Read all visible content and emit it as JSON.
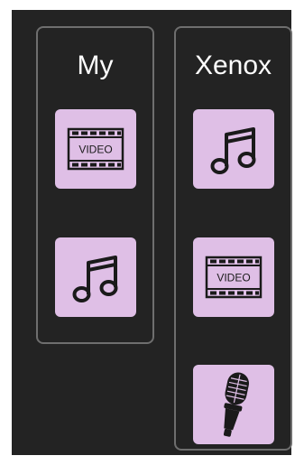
{
  "colors": {
    "screen_background": "#232323",
    "panel_border": "#6e6e6e",
    "tile_background": "#dfbfe6",
    "icon_color": "#1a1a1a",
    "title_text": "#ffffff"
  },
  "panels": [
    {
      "title": "My",
      "tiles": [
        {
          "icon": "video-film-icon",
          "label": "VIDEO"
        },
        {
          "icon": "music-note-icon"
        }
      ]
    },
    {
      "title": "Xenox",
      "tiles": [
        {
          "icon": "music-note-icon"
        },
        {
          "icon": "video-film-icon",
          "label": "VIDEO"
        },
        {
          "icon": "microphone-icon"
        }
      ]
    }
  ]
}
